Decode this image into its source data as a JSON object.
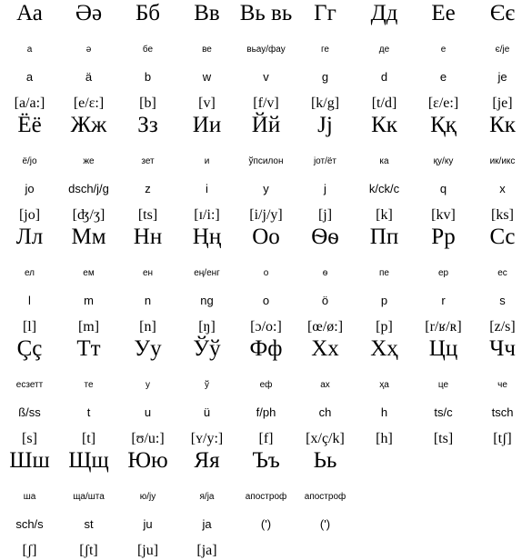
{
  "table": {
    "columns": 9,
    "rows": 5,
    "cells": [
      [
        {
          "letter": "Аа",
          "name": "а",
          "translit": "a",
          "ipa": "[a/a:]"
        },
        {
          "letter": "Әә",
          "name": "ә",
          "translit": "ä",
          "ipa": "[e/ɛ:]"
        },
        {
          "letter": "Бб",
          "name": "бе",
          "translit": "b",
          "ipa": "[b]"
        },
        {
          "letter": "Вв",
          "name": "ве",
          "translit": "w",
          "ipa": "[v]"
        },
        {
          "letter": "Вь вь",
          "name": "вьау/фау",
          "translit": "v",
          "ipa": "[f/v]"
        },
        {
          "letter": "Гг",
          "name": "ге",
          "translit": "g",
          "ipa": "[k/g]"
        },
        {
          "letter": "Дд",
          "name": "де",
          "translit": "d",
          "ipa": "[t/d]"
        },
        {
          "letter": "Ее",
          "name": "е",
          "translit": "e",
          "ipa": "[ɛ/e:]"
        },
        {
          "letter": "Єє",
          "name": "є/je",
          "translit": "je",
          "ipa": "[je]"
        }
      ],
      [
        {
          "letter": "Ёё",
          "name": "ё/jo",
          "translit": "jo",
          "ipa": "[jo]"
        },
        {
          "letter": "Жж",
          "name": "же",
          "translit": "dsch/j/g",
          "ipa": "[ʤ/ʒ]"
        },
        {
          "letter": "Зз",
          "name": "зет",
          "translit": "z",
          "ipa": "[ts]"
        },
        {
          "letter": "Ии",
          "name": "и",
          "translit": "i",
          "ipa": "[ɪ/i:]"
        },
        {
          "letter": "Йй",
          "name": "ўпсилон",
          "translit": "y",
          "ipa": "[i/j/y]"
        },
        {
          "letter": "Јj",
          "name": "јот/ёт",
          "translit": "j",
          "ipa": "[j]"
        },
        {
          "letter": "Кк",
          "name": "ка",
          "translit": "k/ck/c",
          "ipa": "[k]"
        },
        {
          "letter": "Ққ",
          "name": "қу/ку",
          "translit": "q",
          "ipa": "[kv]"
        },
        {
          "letter": "Кк",
          "name": "ик/икс",
          "translit": "x",
          "ipa": "[ks]"
        }
      ],
      [
        {
          "letter": "Лл",
          "name": "ел",
          "translit": "l",
          "ipa": "[l]"
        },
        {
          "letter": "Мм",
          "name": "ем",
          "translit": "m",
          "ipa": "[m]"
        },
        {
          "letter": "Нн",
          "name": "ен",
          "translit": "n",
          "ipa": "[n]"
        },
        {
          "letter": "Ңң",
          "name": "ең/енг",
          "translit": "ng",
          "ipa": "[ŋ]"
        },
        {
          "letter": "Оо",
          "name": "о",
          "translit": "o",
          "ipa": "[ɔ/o:]"
        },
        {
          "letter": "Ѳѳ",
          "name": "ѳ",
          "translit": "ö",
          "ipa": "[œ/ø:]"
        },
        {
          "letter": "Пп",
          "name": "пе",
          "translit": "p",
          "ipa": "[p]"
        },
        {
          "letter": "Рр",
          "name": "ер",
          "translit": "r",
          "ipa": "[r/ʁ/ʀ]"
        },
        {
          "letter": "Сс",
          "name": "ес",
          "translit": "s",
          "ipa": "[z/s]"
        }
      ],
      [
        {
          "letter": "Çç",
          "name": "есзетт",
          "translit": "ß/ss",
          "ipa": "[s]"
        },
        {
          "letter": "Тт",
          "name": "те",
          "translit": "t",
          "ipa": "[t]"
        },
        {
          "letter": "Уу",
          "name": "у",
          "translit": "u",
          "ipa": "[ʊ/u:]"
        },
        {
          "letter": "Ўў",
          "name": "ў",
          "translit": "ü",
          "ipa": "[ʏ/y:]"
        },
        {
          "letter": "Фф",
          "name": "еф",
          "translit": "f/ph",
          "ipa": "[f]"
        },
        {
          "letter": "Хх",
          "name": "ах",
          "translit": "ch",
          "ipa": "[x/ç/k]"
        },
        {
          "letter": "Хҳ",
          "name": "ҳа",
          "translit": "h",
          "ipa": "[h]"
        },
        {
          "letter": "Цц",
          "name": "це",
          "translit": "ts/c",
          "ipa": "[ts]"
        },
        {
          "letter": "Чч",
          "name": "че",
          "translit": "tsch",
          "ipa": "[tʃ]"
        }
      ],
      [
        {
          "letter": "Шш",
          "name": "ша",
          "translit": "sch/s",
          "ipa": "[ʃ]"
        },
        {
          "letter": "Щщ",
          "name": "ща/шта",
          "translit": "st",
          "ipa": "[ʃt]"
        },
        {
          "letter": "Юю",
          "name": "ю/jy",
          "translit": "ju",
          "ipa": "[ju]"
        },
        {
          "letter": "Яя",
          "name": "я/ja",
          "translit": "ja",
          "ipa": "[ja]"
        },
        {
          "letter": "Ъъ",
          "name": "апостроф",
          "translit": "(')",
          "ipa": ""
        },
        {
          "letter": "Ьь",
          "name": "апостроф",
          "translit": "(')",
          "ipa": ""
        },
        {
          "letter": "",
          "name": "",
          "translit": "",
          "ipa": ""
        },
        {
          "letter": "",
          "name": "",
          "translit": "",
          "ipa": ""
        },
        {
          "letter": "",
          "name": "",
          "translit": "",
          "ipa": ""
        }
      ]
    ]
  },
  "colors": {
    "background": "#ffffff",
    "text": "#000000"
  }
}
